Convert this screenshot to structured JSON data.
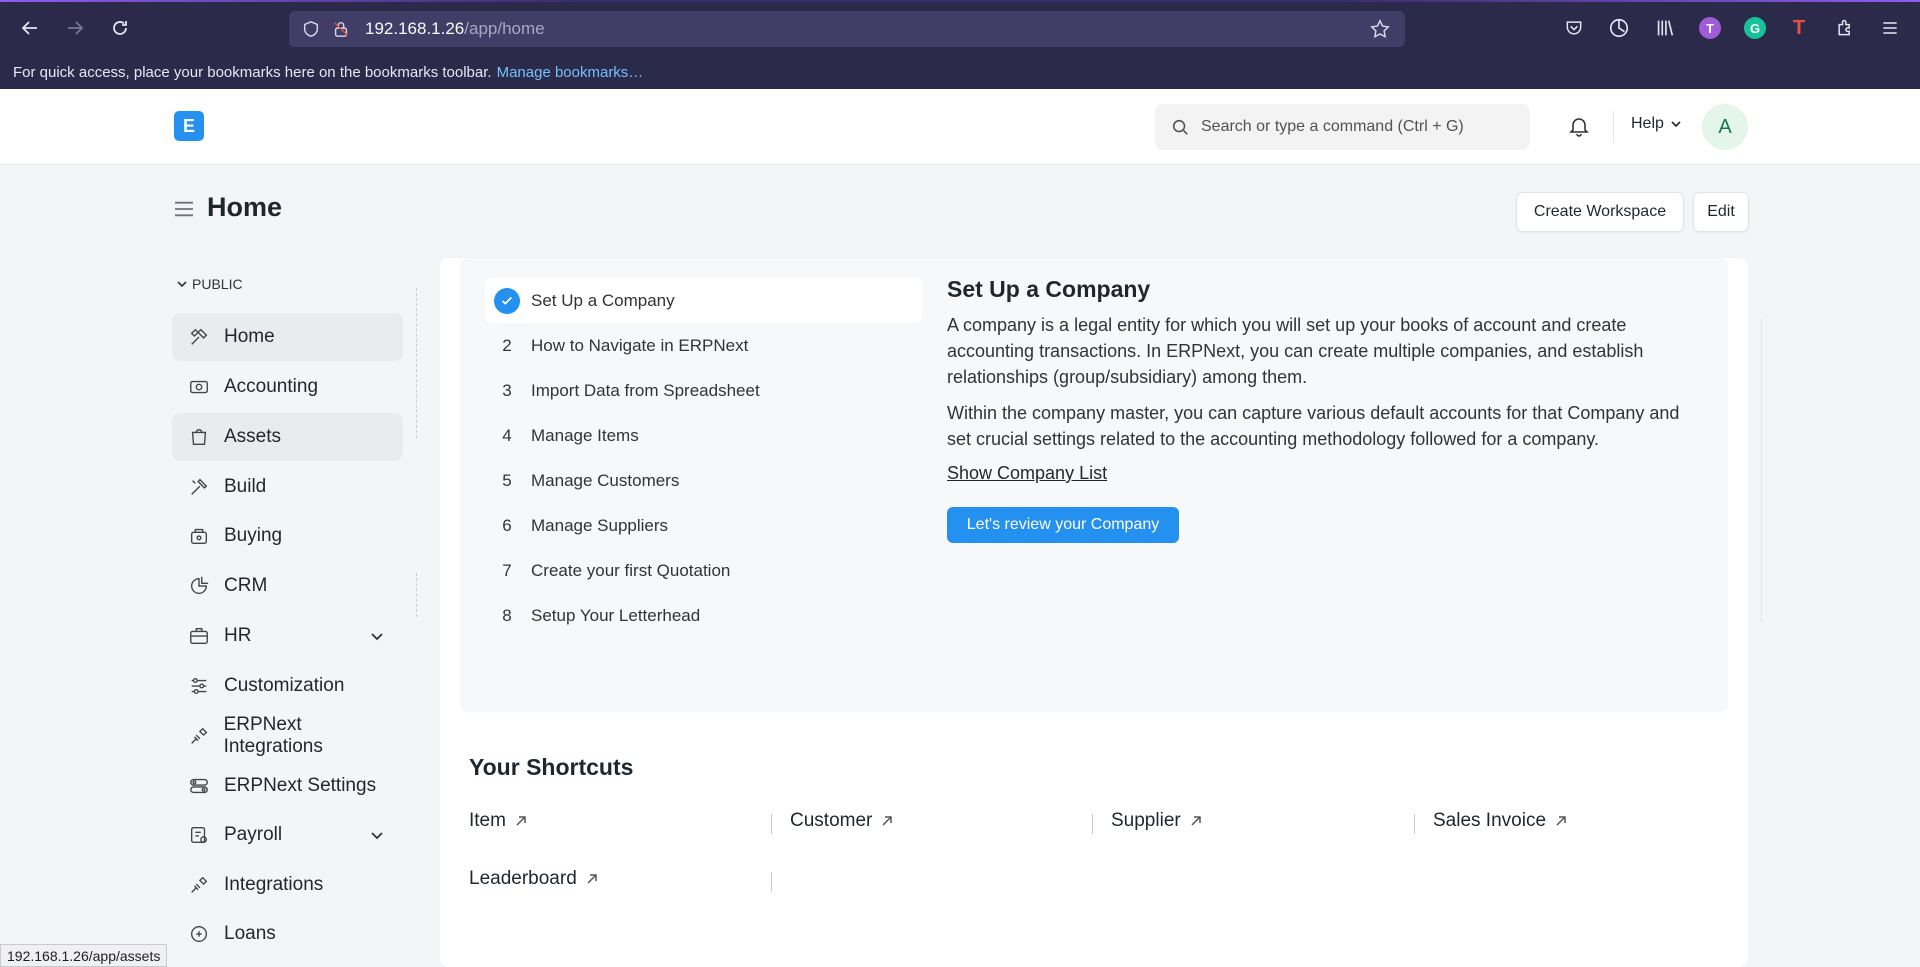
{
  "browser": {
    "url_host": "192.168.1.26",
    "url_path": "/app/home",
    "bookmarks_text": "For quick access, place your bookmarks here on the bookmarks toolbar.",
    "bookmarks_link": "Manage bookmarks…",
    "status_tip": "192.168.1.26/app/assets",
    "toolbar_letters": {
      "t": "T",
      "g": "G",
      "tt": "T"
    }
  },
  "header": {
    "logo_letter": "E",
    "search_placeholder": "Search or type a command (Ctrl + G)",
    "help_label": "Help",
    "avatar_letter": "A"
  },
  "page": {
    "title": "Home",
    "create_workspace": "Create Workspace",
    "edit": "Edit"
  },
  "sidebar": {
    "section": "PUBLIC",
    "items": [
      {
        "label": "Home",
        "icon": "tools-icon",
        "active": true
      },
      {
        "label": "Accounting",
        "icon": "money-icon"
      },
      {
        "label": "Assets",
        "icon": "bag-icon",
        "hover": true
      },
      {
        "label": "Build",
        "icon": "build-icon"
      },
      {
        "label": "Buying",
        "icon": "buying-icon"
      },
      {
        "label": "CRM",
        "icon": "crm-icon"
      },
      {
        "label": "HR",
        "icon": "briefcase-icon",
        "expandable": true
      },
      {
        "label": "Customization",
        "icon": "sliders-icon"
      },
      {
        "label": "ERPNext Integrations",
        "icon": "plug-icon"
      },
      {
        "label": "ERPNext Settings",
        "icon": "settings-icon"
      },
      {
        "label": "Payroll",
        "icon": "payroll-icon",
        "expandable": true
      },
      {
        "label": "Integrations",
        "icon": "plug-icon"
      },
      {
        "label": "Loans",
        "icon": "loan-icon"
      }
    ]
  },
  "onboarding": {
    "steps": [
      {
        "num": "",
        "label": "Set Up a Company",
        "done": true
      },
      {
        "num": "2",
        "label": "How to Navigate in ERPNext"
      },
      {
        "num": "3",
        "label": "Import Data from Spreadsheet"
      },
      {
        "num": "4",
        "label": "Manage Items"
      },
      {
        "num": "5",
        "label": "Manage Customers"
      },
      {
        "num": "6",
        "label": "Manage Suppliers"
      },
      {
        "num": "7",
        "label": "Create your first Quotation"
      },
      {
        "num": "8",
        "label": "Setup Your Letterhead"
      }
    ],
    "detail_title": "Set Up a Company",
    "detail_p1": "A company is a legal entity for which you will set up your books of account and create accounting transactions. In ERPNext, you can create multiple companies, and establish relationships (group/subsidiary) among them.",
    "detail_p2": "Within the company master, you can capture various default accounts for that Company and set crucial settings related to the accounting methodology followed for a company.",
    "show_list": "Show Company List",
    "cta": "Let's review your Company"
  },
  "shortcuts": {
    "title": "Your Shortcuts",
    "items": [
      "Item",
      "Customer",
      "Supplier",
      "Sales Invoice",
      "Leaderboard"
    ]
  },
  "colors": {
    "primary": "#2490ef",
    "browser_bg": "#2b2a4a"
  }
}
